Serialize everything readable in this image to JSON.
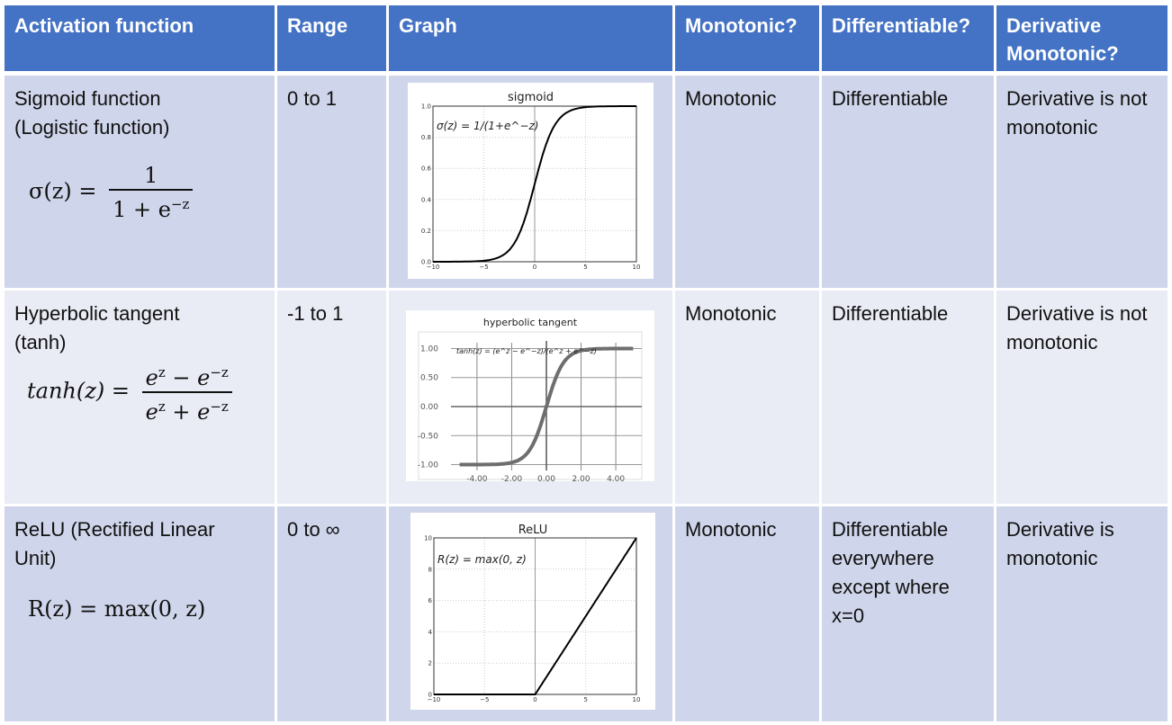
{
  "colors": {
    "header_bg": "#4472c4",
    "row_odd_bg": "#cfd5ea",
    "row_even_bg": "#e9ebf5",
    "header_text": "#ffffff"
  },
  "headers": [
    "Activation function",
    "Range",
    "Graph",
    "Monotonic?",
    "Differentiable?",
    "Derivative Monotonic?"
  ],
  "rows": [
    {
      "name": "Sigmoid function (Logistic function)",
      "formula_lhs": "σ(z) =",
      "formula_num": "1",
      "formula_den": "1 + e",
      "formula_den_sup": "−z",
      "range": "0 to 1",
      "monotonic": "Monotonic",
      "differentiable": "Differentiable",
      "derivative_monotonic": "Derivative is not monotonic"
    },
    {
      "name": "Hyperbolic tangent (tanh)",
      "formula_lhs": "tanh(z) =",
      "formula_num": "e^z − e^−z",
      "formula_den": "e^z + e^−z",
      "range": "-1 to 1",
      "monotonic": "Monotonic",
      "differentiable": "Differentiable",
      "derivative_monotonic": "Derivative is not monotonic"
    },
    {
      "name": "ReLU (Rectified Linear Unit)",
      "formula_lhs": "R(z) = max(0, z)",
      "range": "0 to ∞",
      "monotonic": "Monotonic",
      "differentiable": "Differentiable everywhere except where x=0",
      "derivative_monotonic": "Derivative is monotonic"
    }
  ],
  "chart_data": [
    {
      "type": "line",
      "title": "sigmoid",
      "function": "sigmoid",
      "annotation": "σ(z) = 1/(1+e^−z)",
      "xlim": [
        -10,
        10
      ],
      "ylim": [
        0,
        1
      ],
      "xticks": [
        -10,
        -5,
        0,
        5,
        10
      ],
      "xtick_labels": [
        "−10",
        "−5",
        "0",
        "5",
        "10"
      ],
      "yticks": [
        0,
        0.2,
        0.4,
        0.6,
        0.8,
        1.0
      ],
      "ytick_labels": [
        "0.0",
        "0.2",
        "0.4",
        "0.6",
        "0.8",
        "1.0"
      ],
      "grid": true,
      "line_color": "#000000",
      "x": [
        -10,
        -8,
        -6,
        -5,
        -4,
        -3,
        -2,
        -1,
        0,
        1,
        2,
        3,
        4,
        5,
        6,
        8,
        10
      ],
      "y": [
        0.0,
        0.0003,
        0.0025,
        0.0067,
        0.018,
        0.047,
        0.119,
        0.269,
        0.5,
        0.731,
        0.881,
        0.953,
        0.982,
        0.993,
        0.9975,
        0.9997,
        1.0
      ]
    },
    {
      "type": "line",
      "title": "hyperbolic tangent",
      "function": "tanh",
      "annotation": "tanh(z) = (e^z − e^−z)/(e^z + e^−z)",
      "xlim": [
        -5.5,
        5.5
      ],
      "ylim": [
        -1.1,
        1.1
      ],
      "xticks": [
        -4,
        -2,
        0,
        2,
        4
      ],
      "xtick_labels": [
        "-4.00",
        "-2.00",
        "0.00",
        "2.00",
        "4.00"
      ],
      "yticks": [
        -1,
        -0.5,
        0,
        0.5,
        1
      ],
      "ytick_labels": [
        "-1.00",
        "-0.50",
        "0.00",
        "0.50",
        "1.00"
      ],
      "grid": true,
      "line_color": "#6e6e6e",
      "x": [
        -5,
        -4,
        -3,
        -2,
        -1.5,
        -1,
        -0.5,
        0,
        0.5,
        1,
        1.5,
        2,
        3,
        4,
        5
      ],
      "y": [
        -0.9999,
        -0.9993,
        -0.995,
        -0.964,
        -0.905,
        -0.762,
        -0.462,
        0,
        0.462,
        0.762,
        0.905,
        0.964,
        0.995,
        0.9993,
        0.9999
      ]
    },
    {
      "type": "line",
      "title": "ReLU",
      "function": "relu",
      "annotation": "R(z) = max(0, z)",
      "xlim": [
        -10,
        10
      ],
      "ylim": [
        0,
        10
      ],
      "xticks": [
        -10,
        -5,
        0,
        5,
        10
      ],
      "xtick_labels": [
        "−10",
        "−5",
        "0",
        "5",
        "10"
      ],
      "yticks": [
        0,
        2,
        4,
        6,
        8,
        10
      ],
      "ytick_labels": [
        "0",
        "2",
        "4",
        "6",
        "8",
        "10"
      ],
      "grid": true,
      "line_color": "#000000",
      "x": [
        -10,
        0,
        10
      ],
      "y": [
        0,
        0,
        10
      ]
    }
  ]
}
